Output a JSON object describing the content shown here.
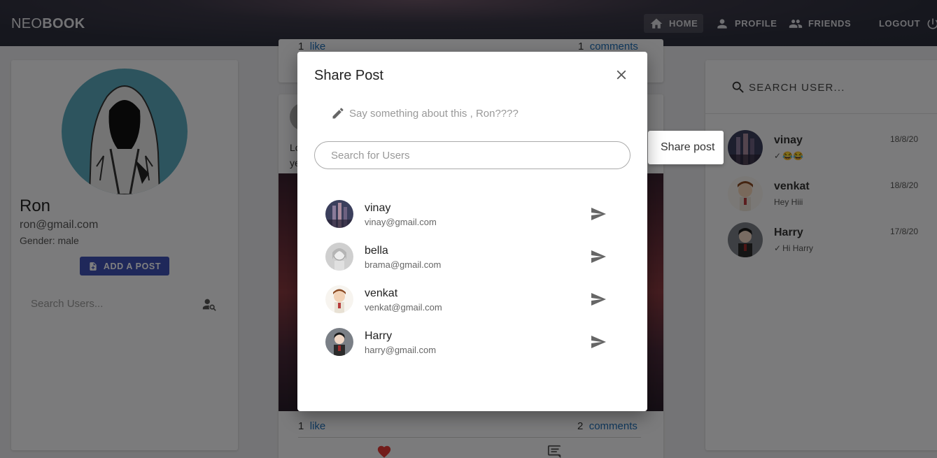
{
  "navbar": {
    "brand_light": "NEO",
    "brand_bold": "BOOK",
    "items": [
      {
        "label": "HOME",
        "icon": "home-icon"
      },
      {
        "label": "PROFILE",
        "icon": "person-icon"
      },
      {
        "label": "FRIENDS",
        "icon": "people-icon"
      },
      {
        "label": "LOGOUT",
        "icon": "power-icon"
      }
    ]
  },
  "profile": {
    "name": "Ron",
    "email": "ron@gmail.com",
    "gender": "Gender: male",
    "add_post_label": "ADD A POST",
    "search_placeholder": "Search Users..."
  },
  "feed": {
    "top_post": {
      "likes": "1",
      "like_label": "like",
      "comments": "1",
      "comments_label": "comments"
    },
    "post": {
      "text_line1": "Lo",
      "text_line2": "ye",
      "likes": "1",
      "like_label": "like",
      "comments": "2",
      "comments_label": "comments"
    }
  },
  "right_panel": {
    "search_label": "SEARCH USER...",
    "chats": [
      {
        "name": "vinay",
        "message": "😂😂",
        "date": "18/8/20",
        "read": true
      },
      {
        "name": "venkat",
        "message": "Hey Hiii",
        "date": "18/8/20",
        "read": false
      },
      {
        "name": "Harry",
        "message": "Hi Harry",
        "date": "17/8/20",
        "read": true
      }
    ]
  },
  "share_menu": {
    "label": "Share post"
  },
  "modal": {
    "title": "Share Post",
    "caption_placeholder": "Say something about this , Ron????",
    "search_placeholder": "Search for Users",
    "users": [
      {
        "name": "vinay",
        "email": "vinay@gmail.com"
      },
      {
        "name": "bella",
        "email": "brama@gmail.com"
      },
      {
        "name": "venkat",
        "email": "venkat@gmail.com"
      },
      {
        "name": "Harry",
        "email": "harry@gmail.com"
      }
    ]
  },
  "colors": {
    "accent": "#3f51b5",
    "link": "#1e6fb8",
    "heart": "#e53935"
  }
}
